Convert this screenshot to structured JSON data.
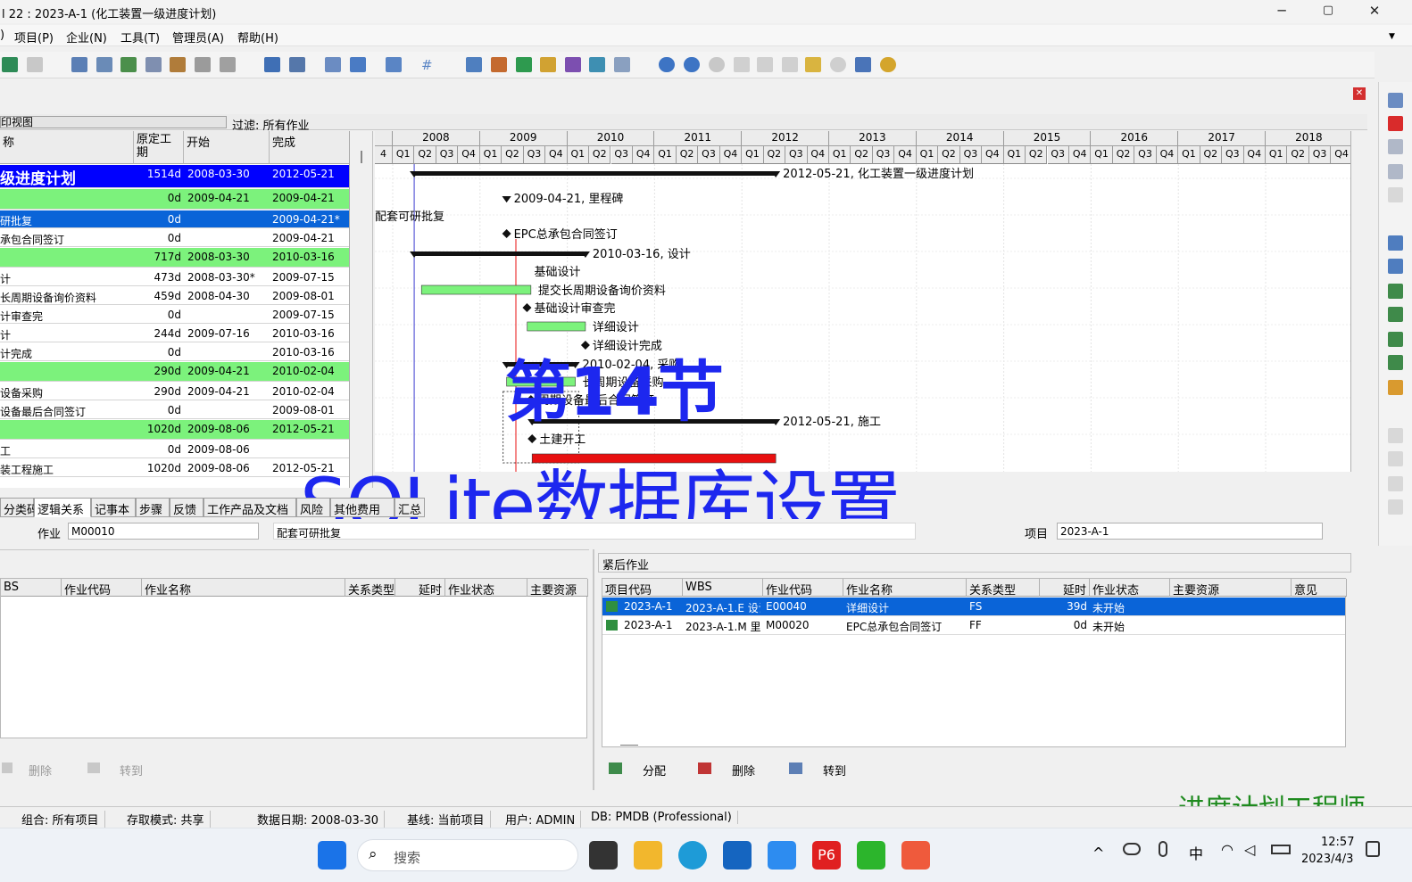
{
  "window": {
    "title": "l 22 : 2023-A-1 (化工装置一级进度计划)",
    "min": "─",
    "max": "▢",
    "close": "✕"
  },
  "menu": [
    "项目(P)",
    "企业(N)",
    "工具(T)",
    "管理员(A)",
    "帮助(H)"
  ],
  "layout": {
    "name": "印视图",
    "filter": "过滤: 所有作业"
  },
  "grid": {
    "headers": [
      "称",
      "原定工期",
      "开始",
      "完成"
    ],
    "rows": [
      {
        "name": "级进度计划",
        "dur": "1514d",
        "start": "2008-03-30",
        "finish": "2012-05-21",
        "style": "wbs1"
      },
      {
        "name": "",
        "dur": "0d",
        "start": "2009-04-21",
        "finish": "2009-04-21",
        "style": "wbs2"
      },
      {
        "name": "研批复",
        "dur": "0d",
        "start": "",
        "finish": "2009-04-21*",
        "style": "sel"
      },
      {
        "name": "承包合同签订",
        "dur": "0d",
        "start": "",
        "finish": "2009-04-21",
        "style": "act"
      },
      {
        "name": "",
        "dur": "717d",
        "start": "2008-03-30",
        "finish": "2010-03-16",
        "style": "wbs2"
      },
      {
        "name": "计",
        "dur": "473d",
        "start": "2008-03-30*",
        "finish": "2009-07-15",
        "style": "act"
      },
      {
        "name": "长周期设备询价资料",
        "dur": "459d",
        "start": "2008-04-30",
        "finish": "2009-08-01",
        "style": "act"
      },
      {
        "name": "计审查完",
        "dur": "0d",
        "start": "",
        "finish": "2009-07-15",
        "style": "act"
      },
      {
        "name": "计",
        "dur": "244d",
        "start": "2009-07-16",
        "finish": "2010-03-16",
        "style": "act"
      },
      {
        "name": "计完成",
        "dur": "0d",
        "start": "",
        "finish": "2010-03-16",
        "style": "act"
      },
      {
        "name": "",
        "dur": "290d",
        "start": "2009-04-21",
        "finish": "2010-02-04",
        "style": "wbs2"
      },
      {
        "name": "设备采购",
        "dur": "290d",
        "start": "2009-04-21",
        "finish": "2010-02-04",
        "style": "act"
      },
      {
        "name": "设备最后合同签订",
        "dur": "0d",
        "start": "",
        "finish": "2009-08-01",
        "style": "act"
      },
      {
        "name": "",
        "dur": "1020d",
        "start": "2009-08-06",
        "finish": "2012-05-21",
        "style": "wbs2"
      },
      {
        "name": "工",
        "dur": "0d",
        "start": "2009-08-06",
        "finish": "",
        "style": "act"
      },
      {
        "name": "装工程施工",
        "dur": "1020d",
        "start": "2009-08-06",
        "finish": "2012-05-21",
        "style": "act"
      }
    ]
  },
  "gantt": {
    "years": [
      "2008",
      "2009",
      "2010",
      "2011",
      "2012",
      "2013",
      "2014",
      "2015",
      "2016",
      "2017",
      "2018"
    ],
    "quarters": [
      "Q1",
      "Q2",
      "Q3",
      "Q4"
    ],
    "leading_quarter": "4",
    "labels": [
      "2012-05-21, 化工装置一级进度计划",
      "2009-04-21, 里程碑",
      "配套可研批复",
      "EPC总承包合同签订",
      "2010-03-16, 设计",
      "基础设计",
      "提交长周期设备询价资料",
      "基础设计审查完",
      "详细设计",
      "详细设计完成",
      "2010-02-04, 采购",
      "长周期设备采购",
      "周期设备最后合同签订",
      "2012-05-21, 施工",
      "土建开工"
    ]
  },
  "tabs": [
    "分类码",
    "逻辑关系",
    "记事本",
    "步骤",
    "反馈",
    "工作产品及文档",
    "风险",
    "其他费用",
    "汇总"
  ],
  "detail": {
    "activity_label": "作业",
    "activity_code": "M00010",
    "activity_name": "配套可研批复",
    "project_label": "项目",
    "project_value": "2023-A-1"
  },
  "predecessors": {
    "headers": [
      "BS",
      "作业代码",
      "作业名称",
      "关系类型",
      "延时",
      "作业状态",
      "主要资源"
    ],
    "buttons": [
      "删除",
      "转到"
    ]
  },
  "successors": {
    "title": "紧后作业",
    "headers": [
      "项目代码",
      "WBS",
      "作业代码",
      "作业名称",
      "关系类型",
      "延时",
      "作业状态",
      "主要资源",
      "意见"
    ],
    "rows": [
      {
        "project": "2023-A-1",
        "wbs": "2023-A-1.E 设计",
        "code": "E00040",
        "name": "详细设计",
        "type": "FS",
        "lag": "39d",
        "status": "未开始",
        "res": "",
        "note": ""
      },
      {
        "project": "2023-A-1",
        "wbs": "2023-A-1.M 里",
        "code": "M00020",
        "name": "EPC总承包合同签订",
        "type": "FF",
        "lag": "0d",
        "status": "未开始",
        "res": "",
        "note": ""
      }
    ],
    "buttons": [
      "分配",
      "删除",
      "转到"
    ]
  },
  "status": {
    "portfolio": "组合: 所有项目",
    "access": "存取模式: 共享",
    "datadate": "数据日期: 2008-03-30",
    "baseline": "基线: 当前项目",
    "user": "用户: ADMIN",
    "db": "DB: PMDB (Professional)"
  },
  "overlay": {
    "line1": "第14节",
    "line2": "SQLite数据库设置",
    "watermark": "进度计划工程师"
  },
  "taskbar": {
    "search": "搜索",
    "time": "12:57",
    "date": "2023/4/3",
    "ime": "中"
  },
  "colors": {
    "wbs1": "#0000ff",
    "wbs2": "#7cf27c",
    "selected": "#0a64d8",
    "critical": "#e81010",
    "normal_bar": "#7cf27c"
  }
}
